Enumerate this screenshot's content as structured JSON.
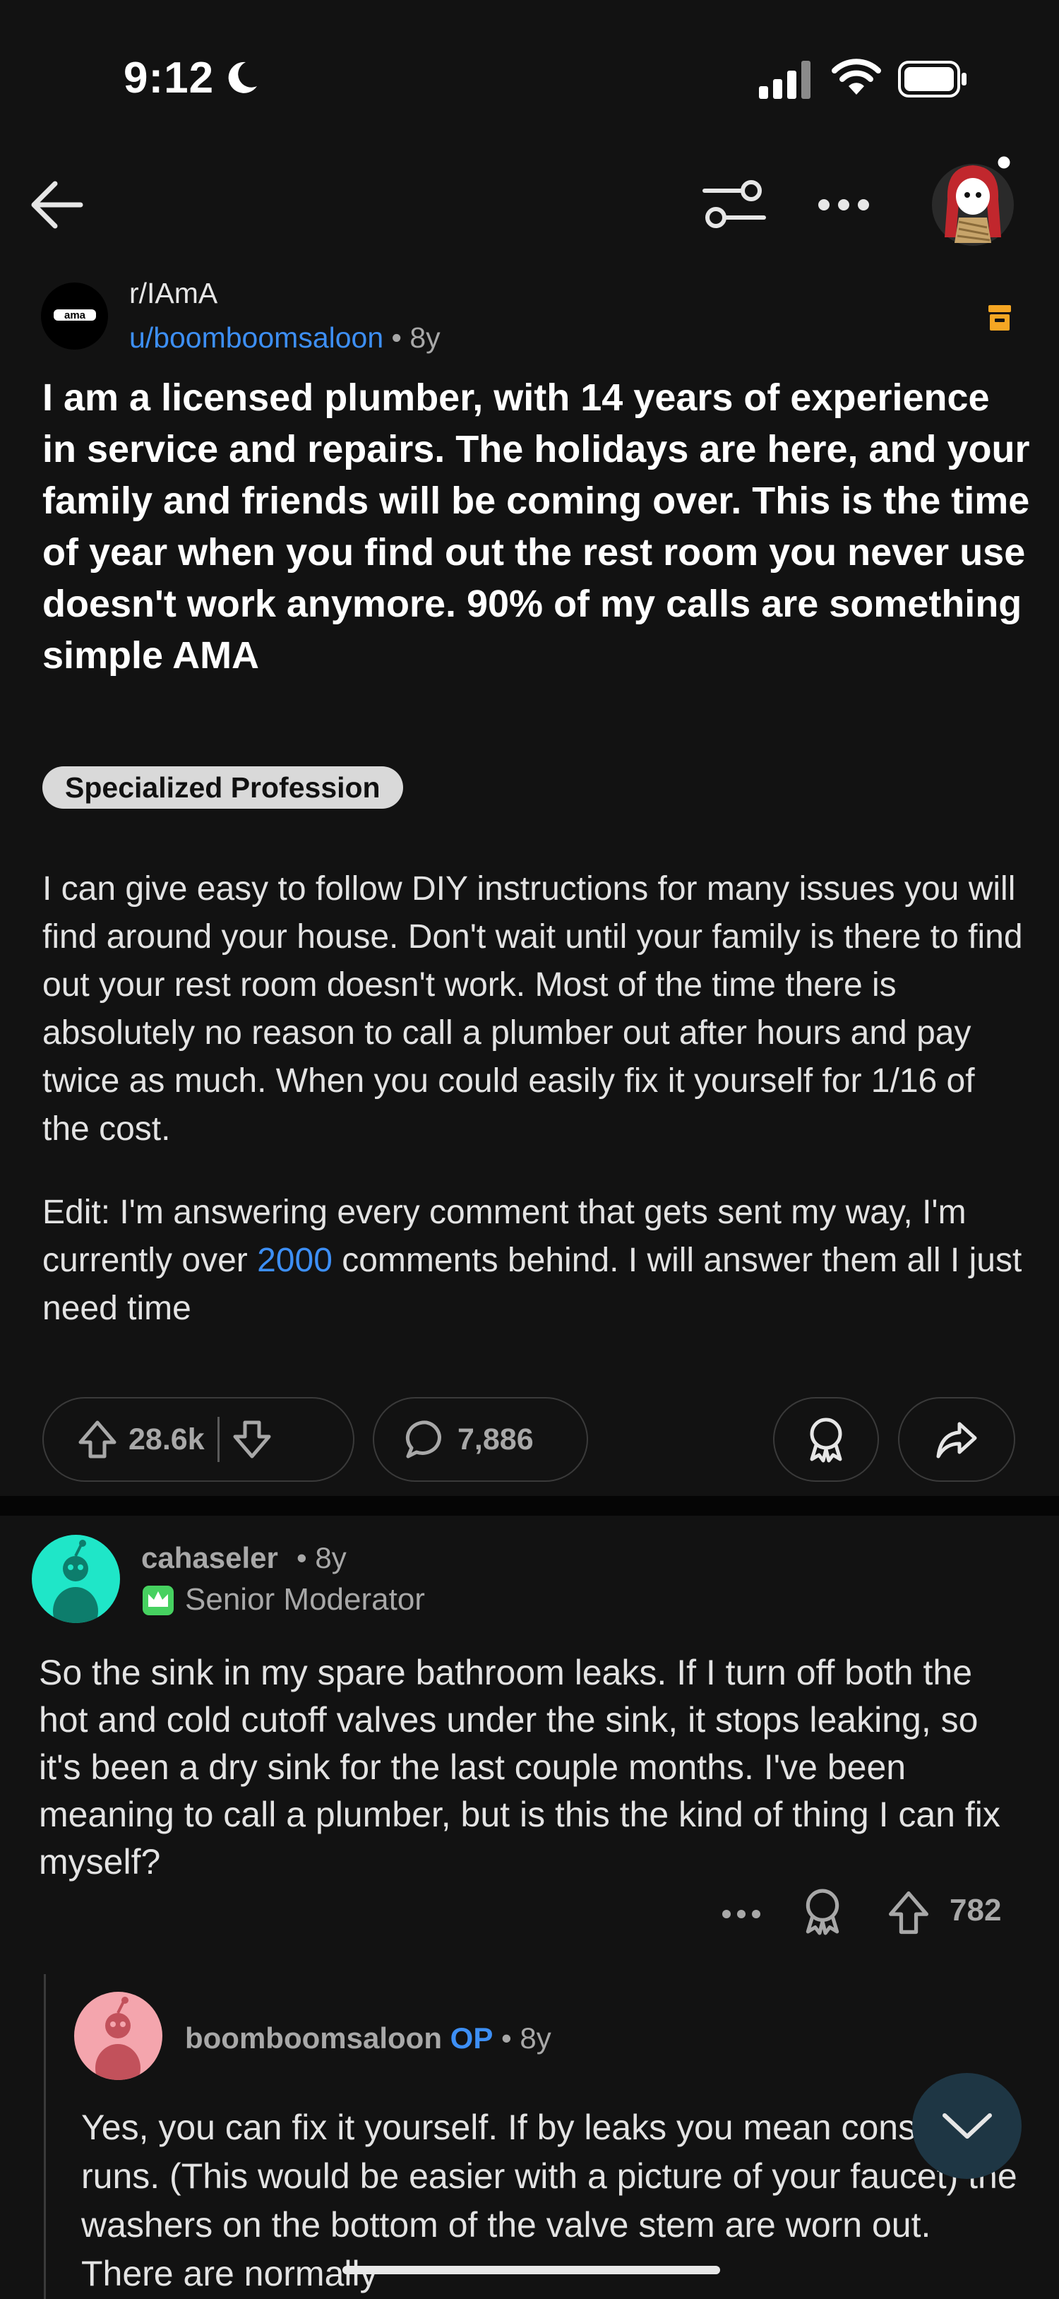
{
  "status_bar": {
    "time": "9:12"
  },
  "post": {
    "subreddit": "r/IAmA",
    "subreddit_icon_text": "ama",
    "username": "u/boomboomsaloon",
    "separator": "•",
    "age": "8y",
    "title": "I am a licensed plumber, with 14 years of experience in service and repairs. The holidays are here, and your family and friends will be coming over. This is the time of year when you find out the rest room you never use doesn't work anymore. 90% of my calls are something simple AMA",
    "flair": "Specialized Profession",
    "body_p1": "I can give easy to follow DIY instructions for many issues you will find around your house. Don't wait until your family is there to find out your rest room doesn't work. Most of the time there is absolutely no reason to call a plumber out after hours and pay twice as much. When you could easily fix it yourself for 1/16 of the cost.",
    "body_p2_before": "Edit: I'm answering every comment that gets sent my way, I'm currently over ",
    "body_p2_link": "2000",
    "body_p2_after": "  comments behind. I will answer them all I just need time",
    "upvotes": "28.6k",
    "comments": "7,886"
  },
  "comment": {
    "username": "cahaseler",
    "separator": "•",
    "age": "8y",
    "badge": "Senior Moderator",
    "body": "So the sink in my spare bathroom leaks. If I turn off both the hot and cold cutoff valves under the sink, it stops leaking, so it's been a dry sink for the last couple months. I've been meaning to call a plumber, but is this the kind of thing I can fix myself?",
    "score": "782"
  },
  "reply": {
    "username": "boomboomsaloon",
    "op_label": "OP",
    "separator": "•",
    "age": "8y",
    "body": "Yes, you can fix it yourself. If by leaks you mean constantly runs. (This would be easier with a picture of your faucet) the washers on the bottom of the valve stem are worn out. There are normally"
  },
  "colors": {
    "background": "#121212",
    "link_blue": "#3d8ff5",
    "archive_orange": "#f5a623",
    "mod_green": "#46d160"
  }
}
